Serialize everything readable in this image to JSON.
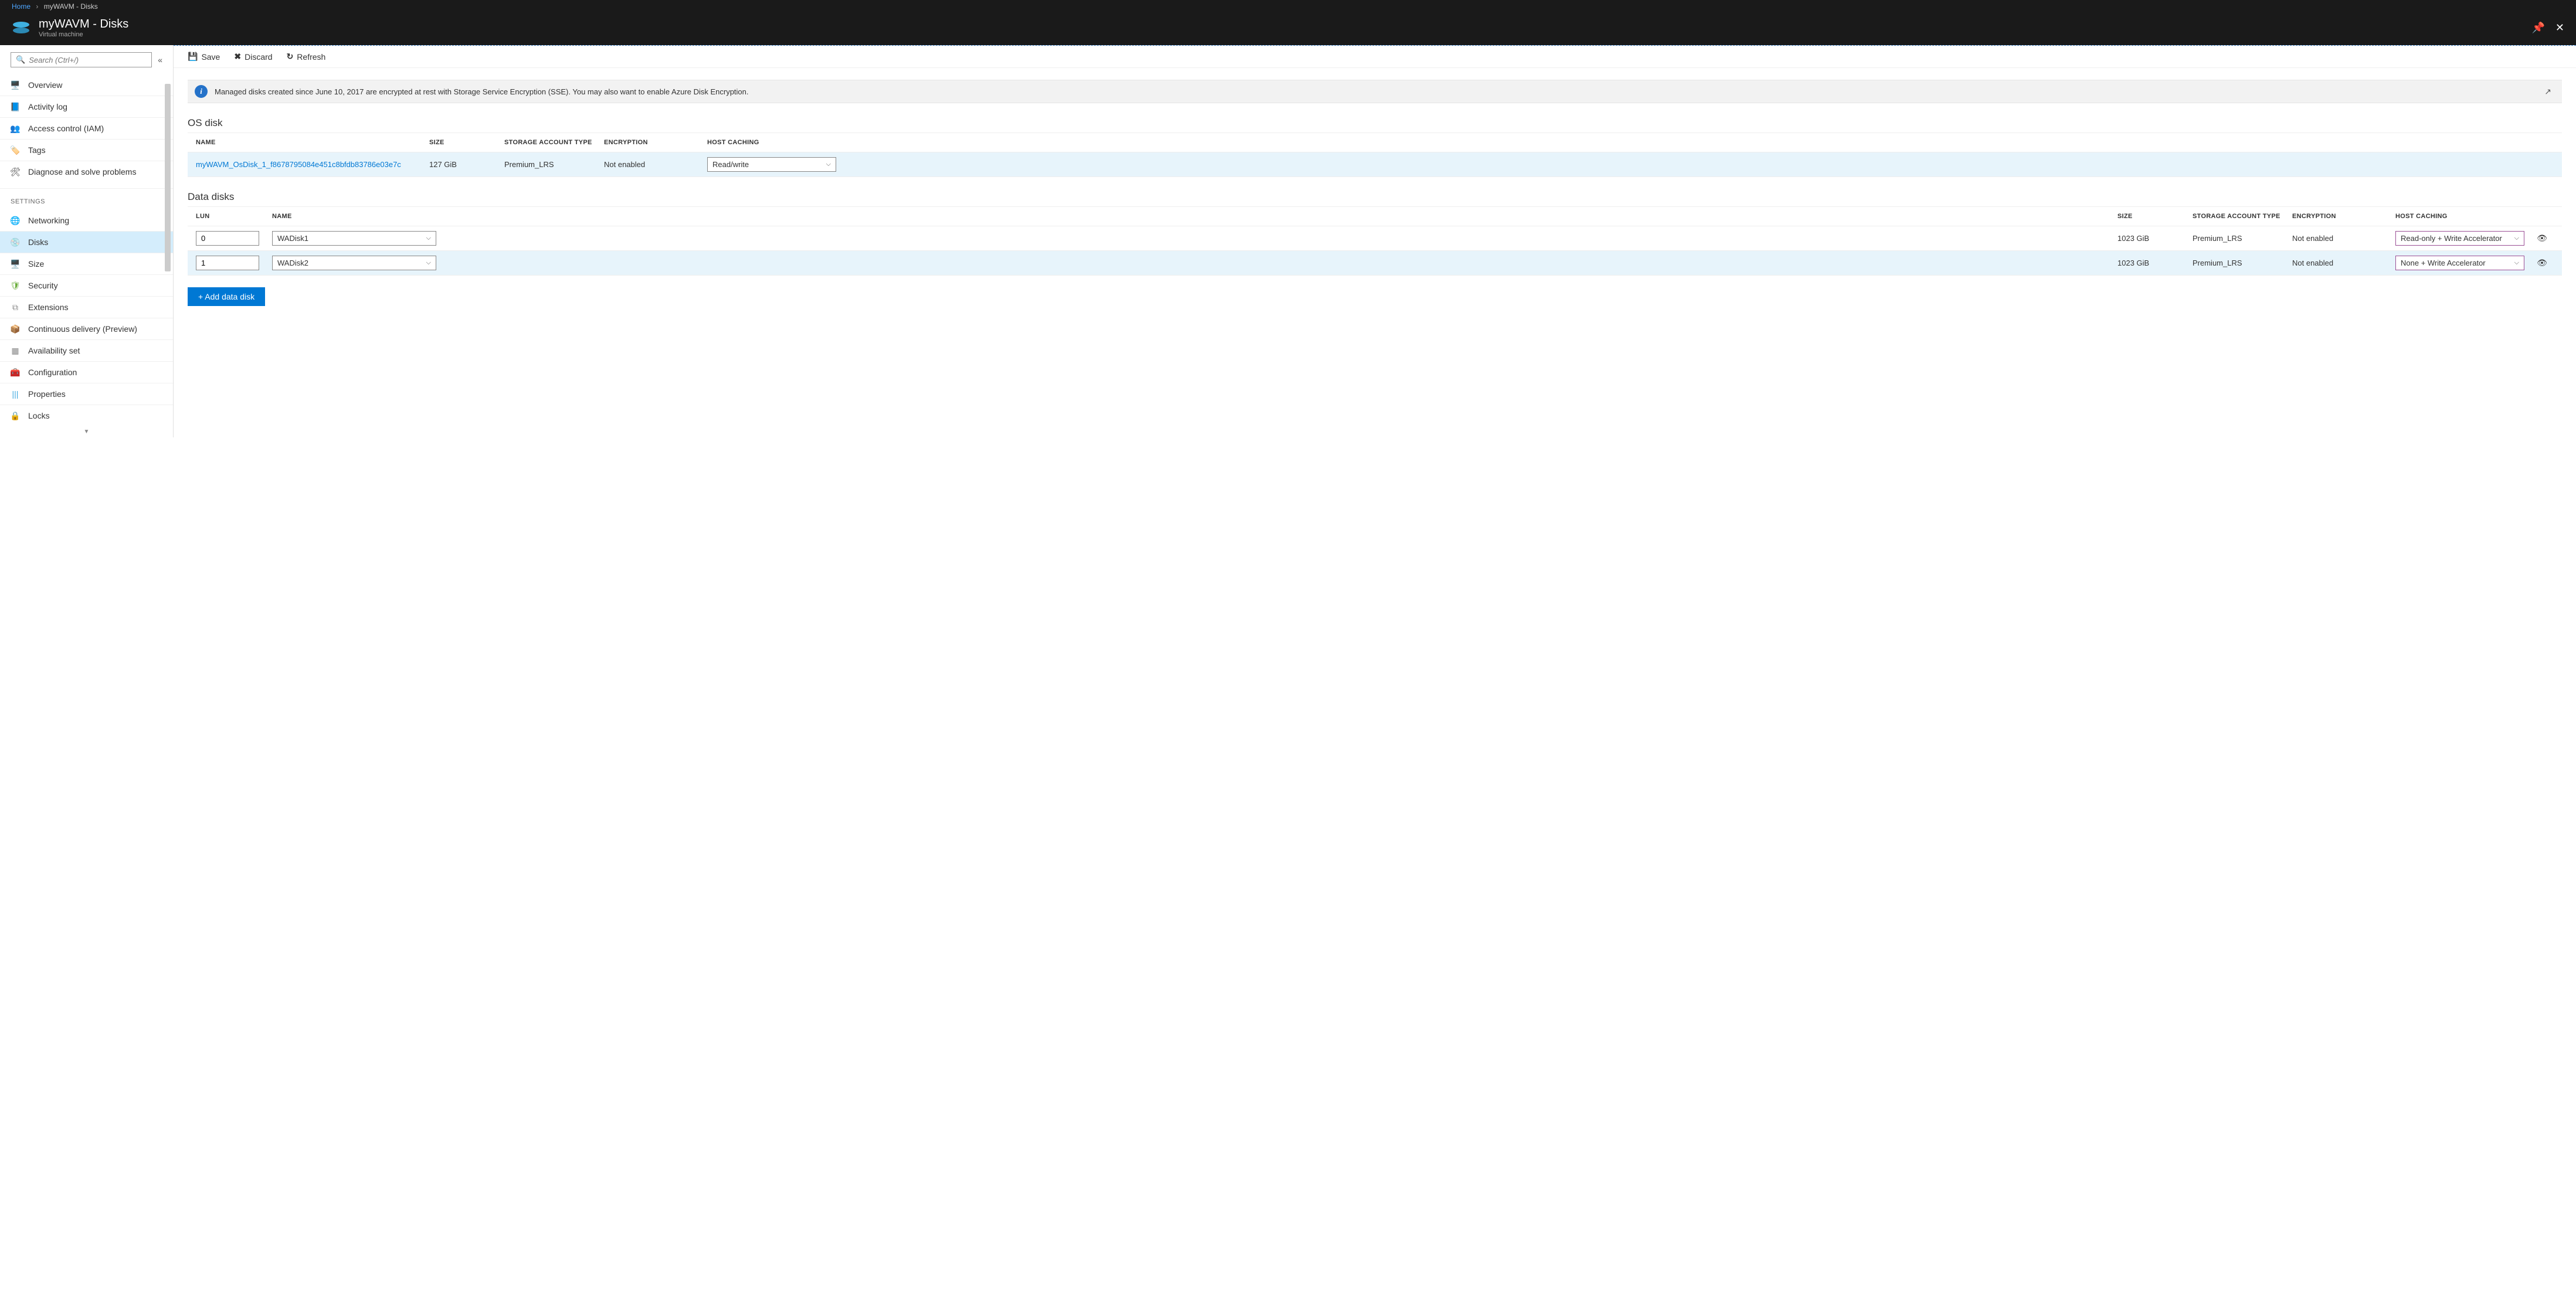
{
  "breadcrumb": {
    "home": "Home",
    "current": "myWAVM - Disks"
  },
  "header": {
    "title": "myWAVM - Disks",
    "sub": "Virtual machine"
  },
  "search": {
    "placeholder": "Search (Ctrl+/)"
  },
  "nav": {
    "items1": [
      {
        "label": "Overview",
        "icon": "🖥️",
        "color": "#2e8ad8"
      },
      {
        "label": "Activity log",
        "icon": "📘",
        "color": "#1f6fc2"
      },
      {
        "label": "Access control (IAM)",
        "icon": "👥",
        "color": "#2e8ad8"
      },
      {
        "label": "Tags",
        "icon": "🏷️",
        "color": "#8c4fa3"
      },
      {
        "label": "Diagnose and solve problems",
        "icon": "🛠",
        "color": "#333"
      }
    ],
    "heading": "SETTINGS",
    "items2": [
      {
        "label": "Networking",
        "icon": "🌐",
        "color": "#3fa9e0",
        "active": false
      },
      {
        "label": "Disks",
        "icon": "💿",
        "color": "#3fa9e0",
        "active": true
      },
      {
        "label": "Size",
        "icon": "🖥️",
        "color": "#2e8ad8",
        "active": false
      },
      {
        "label": "Security",
        "icon": "🛡",
        "color": "#6cae3e",
        "active": false
      },
      {
        "label": "Extensions",
        "icon": "⧉",
        "color": "#888",
        "active": false
      },
      {
        "label": "Continuous delivery (Preview)",
        "icon": "📦",
        "color": "#3fa9e0",
        "active": false
      },
      {
        "label": "Availability set",
        "icon": "▦",
        "color": "#888",
        "active": false
      },
      {
        "label": "Configuration",
        "icon": "🧰",
        "color": "#c0392b",
        "active": false
      },
      {
        "label": "Properties",
        "icon": "|||",
        "color": "#3fa9e0",
        "active": false
      },
      {
        "label": "Locks",
        "icon": "🔒",
        "color": "#333",
        "active": false
      }
    ]
  },
  "toolbar": {
    "save": "Save",
    "discard": "Discard",
    "refresh": "Refresh"
  },
  "banner": {
    "text": "Managed disks created since June 10, 2017 are encrypted at rest with Storage Service Encryption (SSE). You may also want to enable Azure Disk Encryption."
  },
  "os_section": {
    "title": "OS disk",
    "headers": {
      "name": "NAME",
      "size": "SIZE",
      "storage": "STORAGE ACCOUNT TYPE",
      "enc": "ENCRYPTION",
      "cache": "HOST CACHING"
    },
    "row": {
      "name": "myWAVM_OsDisk_1_f8678795084e451c8bfdb83786e03e7c",
      "size": "127 GiB",
      "storage": "Premium_LRS",
      "enc": "Not enabled",
      "cache": "Read/write"
    }
  },
  "data_section": {
    "title": "Data disks",
    "headers": {
      "lun": "LUN",
      "name": "NAME",
      "size": "SIZE",
      "storage": "STORAGE ACCOUNT TYPE",
      "enc": "ENCRYPTION",
      "cache": "HOST CACHING"
    },
    "rows": [
      {
        "lun": "0",
        "name": "WADisk1",
        "size": "1023 GiB",
        "storage": "Premium_LRS",
        "enc": "Not enabled",
        "cache": "Read-only + Write Accelerator"
      },
      {
        "lun": "1",
        "name": "WADisk2",
        "size": "1023 GiB",
        "storage": "Premium_LRS",
        "enc": "Not enabled",
        "cache": "None + Write Accelerator"
      }
    ],
    "add": "+ Add data disk"
  }
}
